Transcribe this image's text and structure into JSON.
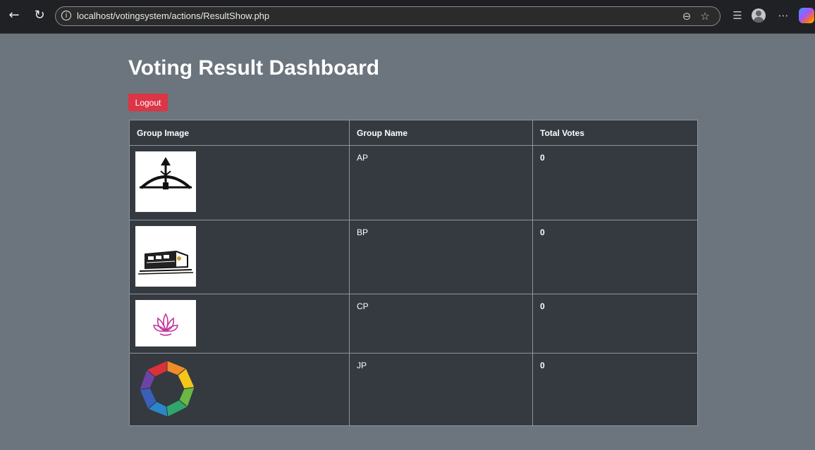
{
  "browser": {
    "url": "localhost/votingsystem/actions/ResultShow.php",
    "icons": [
      "back-arrow-icon",
      "refresh-icon",
      "info-icon",
      "zoom-out-icon",
      "favorite-star-icon",
      "favorites-list-icon",
      "profile-icon",
      "more-icon",
      "copilot-icon"
    ]
  },
  "page": {
    "title": "Voting Result Dashboard",
    "logout_label": "Logout"
  },
  "table": {
    "headers": [
      "Group Image",
      "Group Name",
      "Total Votes"
    ],
    "rows": [
      {
        "image": "bow-and-arrow-logo",
        "name": "AP",
        "votes": "0"
      },
      {
        "image": "train-logo",
        "name": "BP",
        "votes": "0"
      },
      {
        "image": "lotus-logo",
        "name": "CP",
        "votes": "0"
      },
      {
        "image": "rainbow-ring-logo",
        "name": "JP",
        "votes": "0"
      }
    ]
  },
  "colors": {
    "page_background": "#6c757d",
    "table_background": "#343a40",
    "logout_button": "#dc3545"
  }
}
